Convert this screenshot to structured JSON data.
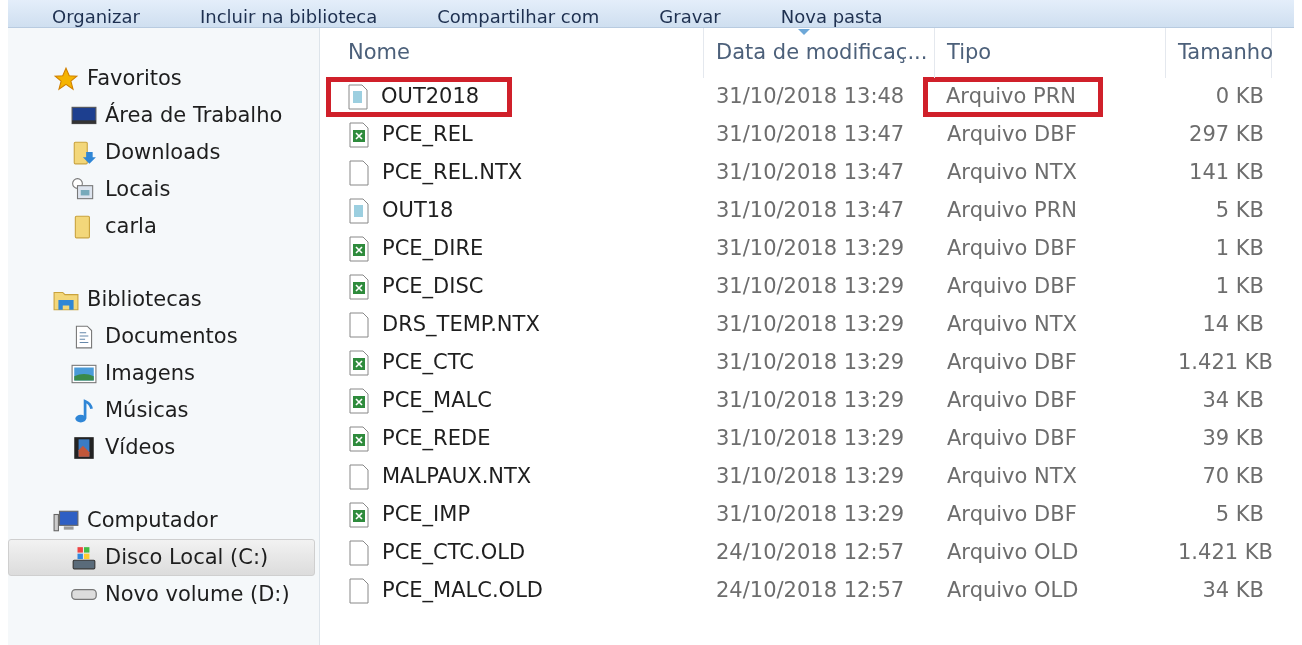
{
  "toolbar": [
    "Organizar",
    "Incluir na biblioteca",
    "Compartilhar com",
    "Gravar",
    "Nova pasta"
  ],
  "sidebar": [
    {
      "label": "Favoritos",
      "kind": "star",
      "selected": false,
      "children": [
        {
          "label": "Área de Trabalho",
          "kind": "desktop",
          "selected": false
        },
        {
          "label": "Downloads",
          "kind": "downloads",
          "selected": false
        },
        {
          "label": "Locais",
          "kind": "recent",
          "selected": false
        },
        {
          "label": "carla",
          "kind": "folder",
          "selected": false
        }
      ]
    },
    {
      "label": "Bibliotecas",
      "kind": "library",
      "selected": false,
      "children": [
        {
          "label": "Documentos",
          "kind": "document",
          "selected": false
        },
        {
          "label": "Imagens",
          "kind": "image",
          "selected": false
        },
        {
          "label": "Músicas",
          "kind": "music",
          "selected": false
        },
        {
          "label": "Vídeos",
          "kind": "video",
          "selected": false
        }
      ]
    },
    {
      "label": "Computador",
      "kind": "computer",
      "selected": false,
      "children": [
        {
          "label": "Disco Local (C:)",
          "kind": "drive_c",
          "selected": true
        },
        {
          "label": "Novo volume (D:)",
          "kind": "drive",
          "selected": false
        }
      ]
    }
  ],
  "columns": [
    "Nome",
    "Data de modificaç...",
    "Tipo",
    "Tamanho"
  ],
  "rows": [
    {
      "name": "OUT2018",
      "date": "31/10/2018 13:48",
      "type": "Arquivo PRN",
      "size": "0 KB",
      "kind": "prn",
      "name_boxed": true,
      "type_boxed": true
    },
    {
      "name": "PCE_REL",
      "date": "31/10/2018 13:47",
      "type": "Arquivo DBF",
      "size": "297 KB",
      "kind": "dbf",
      "name_boxed": false,
      "type_boxed": false
    },
    {
      "name": "PCE_REL.NTX",
      "date": "31/10/2018 13:47",
      "type": "Arquivo NTX",
      "size": "141 KB",
      "kind": "blank",
      "name_boxed": false,
      "type_boxed": false
    },
    {
      "name": "OUT18",
      "date": "31/10/2018 13:47",
      "type": "Arquivo PRN",
      "size": "5 KB",
      "kind": "prn",
      "name_boxed": false,
      "type_boxed": false
    },
    {
      "name": "PCE_DIRE",
      "date": "31/10/2018 13:29",
      "type": "Arquivo DBF",
      "size": "1 KB",
      "kind": "dbf",
      "name_boxed": false,
      "type_boxed": false
    },
    {
      "name": "PCE_DISC",
      "date": "31/10/2018 13:29",
      "type": "Arquivo DBF",
      "size": "1 KB",
      "kind": "dbf",
      "name_boxed": false,
      "type_boxed": false
    },
    {
      "name": "DRS_TEMP.NTX",
      "date": "31/10/2018 13:29",
      "type": "Arquivo NTX",
      "size": "14 KB",
      "kind": "blank",
      "name_boxed": false,
      "type_boxed": false
    },
    {
      "name": "PCE_CTC",
      "date": "31/10/2018 13:29",
      "type": "Arquivo DBF",
      "size": "1.421 KB",
      "kind": "dbf",
      "name_boxed": false,
      "type_boxed": false
    },
    {
      "name": "PCE_MALC",
      "date": "31/10/2018 13:29",
      "type": "Arquivo DBF",
      "size": "34 KB",
      "kind": "dbf",
      "name_boxed": false,
      "type_boxed": false
    },
    {
      "name": "PCE_REDE",
      "date": "31/10/2018 13:29",
      "type": "Arquivo DBF",
      "size": "39 KB",
      "kind": "dbf",
      "name_boxed": false,
      "type_boxed": false
    },
    {
      "name": "MALPAUX.NTX",
      "date": "31/10/2018 13:29",
      "type": "Arquivo NTX",
      "size": "70 KB",
      "kind": "blank",
      "name_boxed": false,
      "type_boxed": false
    },
    {
      "name": "PCE_IMP",
      "date": "31/10/2018 13:29",
      "type": "Arquivo DBF",
      "size": "5 KB",
      "kind": "dbf",
      "name_boxed": false,
      "type_boxed": false
    },
    {
      "name": "PCE_CTC.OLD",
      "date": "24/10/2018 12:57",
      "type": "Arquivo OLD",
      "size": "1.421 KB",
      "kind": "blank",
      "name_boxed": false,
      "type_boxed": false
    },
    {
      "name": "PCE_MALC.OLD",
      "date": "24/10/2018 12:57",
      "type": "Arquivo OLD",
      "size": "34 KB",
      "kind": "blank",
      "name_boxed": false,
      "type_boxed": false
    }
  ]
}
